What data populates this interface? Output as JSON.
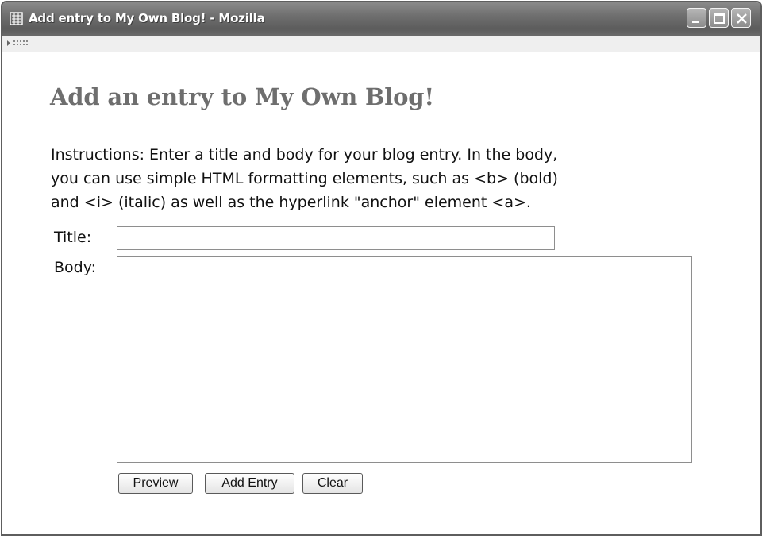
{
  "window": {
    "title": "Add entry to My Own Blog! - Mozilla",
    "app_icon": "mozilla-app-icon",
    "controls": {
      "minimize": "minimize-icon",
      "maximize": "maximize-icon",
      "close": "close-icon"
    }
  },
  "page": {
    "heading": "Add an entry to My Own Blog!",
    "instructions": [
      "Instructions: Enter a title and body for your blog entry. In the body,",
      "you can use simple HTML formatting elements, such as <b> (bold)",
      "and <i> (italic) as well as the hyperlink \"anchor\" element <a>."
    ],
    "form": {
      "title_label": "Title:",
      "title_value": "",
      "body_label": "Body:",
      "body_value": "",
      "buttons": {
        "preview": "Preview",
        "add_entry": "Add Entry",
        "clear": "Clear"
      }
    }
  },
  "colors": {
    "titlebar": "#6f6f6f",
    "heading": "#6e6e6e",
    "text": "#111111"
  }
}
